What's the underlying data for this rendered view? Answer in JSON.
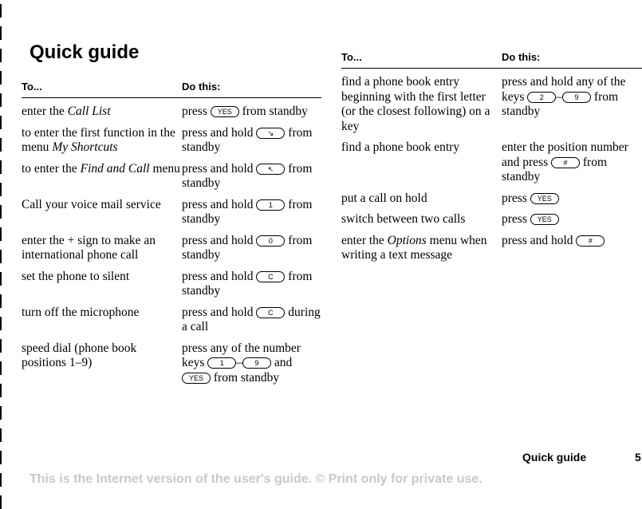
{
  "page": {
    "title": "Quick guide",
    "footer_section": "Quick guide",
    "page_number": "5",
    "notice": "This is the Internet version of the user's guide. © Print only for private use."
  },
  "left_table": {
    "header_to": "To...",
    "header_do": "Do this:",
    "rows": [
      {
        "to": [
          {
            "t": "enter the "
          },
          {
            "t": "Call List",
            "i": true
          }
        ],
        "do": [
          {
            "t": "press "
          },
          {
            "k": "YES"
          },
          {
            "t": " from standby"
          }
        ]
      },
      {
        "to": [
          {
            "t": "to enter the first function in the menu "
          },
          {
            "t": "My Shortcuts",
            "i": true
          }
        ],
        "do": [
          {
            "t": "press and hold "
          },
          {
            "k": "↘"
          },
          {
            "t": " from standby"
          }
        ]
      },
      {
        "to": [
          {
            "t": "to enter the "
          },
          {
            "t": "Find and Call",
            "i": true
          },
          {
            "t": " menu"
          }
        ],
        "do": [
          {
            "t": "press and hold "
          },
          {
            "k": "↖"
          },
          {
            "t": " from standby"
          }
        ]
      },
      {
        "to": [
          {
            "t": "Call your voice mail service"
          }
        ],
        "do": [
          {
            "t": "press and hold "
          },
          {
            "k": "1"
          },
          {
            "t": " from standby"
          }
        ]
      },
      {
        "to": [
          {
            "t": "enter the + sign to make an international phone call"
          }
        ],
        "do": [
          {
            "t": "press and hold "
          },
          {
            "k": "0"
          },
          {
            "t": " from standby"
          }
        ]
      },
      {
        "to": [
          {
            "t": "set the phone to silent"
          }
        ],
        "do": [
          {
            "t": "press and hold "
          },
          {
            "k": "C"
          },
          {
            "t": " from standby"
          }
        ]
      },
      {
        "to": [
          {
            "t": "turn off the microphone"
          }
        ],
        "do": [
          {
            "t": "press and hold "
          },
          {
            "k": "C"
          },
          {
            "t": " during a call"
          }
        ]
      },
      {
        "to": [
          {
            "t": "speed dial (phone book positions 1–9)"
          }
        ],
        "do": [
          {
            "t": "press any of the number keys "
          },
          {
            "k": "1"
          },
          {
            "t": "–"
          },
          {
            "k": "9"
          },
          {
            "t": " and "
          },
          {
            "k": "YES"
          },
          {
            "t": " from standby"
          }
        ]
      }
    ]
  },
  "right_table": {
    "header_to": "To...",
    "header_do": "Do this:",
    "rows": [
      {
        "to": [
          {
            "t": "find a phone book entry beginning with the first letter (or the closest following) on a key"
          }
        ],
        "do": [
          {
            "t": "press and hold any of the keys "
          },
          {
            "k": "2"
          },
          {
            "t": "–"
          },
          {
            "k": "9"
          },
          {
            "t": " from standby"
          }
        ]
      },
      {
        "to": [
          {
            "t": "find a phone book entry"
          }
        ],
        "do": [
          {
            "t": "enter the position number and press "
          },
          {
            "k": "#"
          },
          {
            "t": " from standby"
          }
        ]
      },
      {
        "to": [
          {
            "t": "put a call on hold"
          }
        ],
        "do": [
          {
            "t": "press "
          },
          {
            "k": "YES"
          }
        ]
      },
      {
        "to": [
          {
            "t": "switch between two calls"
          }
        ],
        "do": [
          {
            "t": "press "
          },
          {
            "k": "YES"
          }
        ]
      },
      {
        "to": [
          {
            "t": "enter the "
          },
          {
            "t": "Options",
            "i": true
          },
          {
            "t": " menu when writing a text message"
          }
        ],
        "do": [
          {
            "t": "press and hold "
          },
          {
            "k": "#"
          }
        ]
      }
    ]
  }
}
